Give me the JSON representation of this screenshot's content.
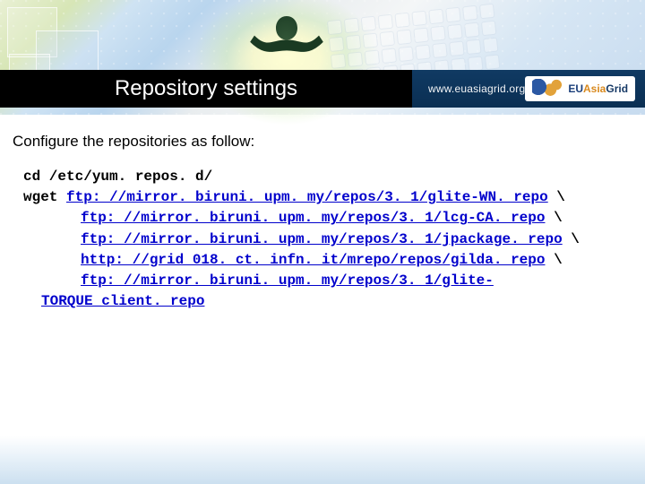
{
  "header": {
    "title": "Repository settings",
    "site_url": "www.euasiagrid.org",
    "brand": {
      "part1": "EU",
      "part2": "Asia",
      "part3": "Grid"
    }
  },
  "content": {
    "intro": "Configure the repositories as follow:",
    "cmd_cd": "cd /etc/yum. repos. d/",
    "cmd_wget": "wget",
    "links": {
      "l1": "ftp: //mirror. biruni. upm. my/repos/3. 1/glite-WN. repo",
      "l2": "ftp: //mirror. biruni. upm. my/repos/3. 1/lcg-CA. repo",
      "l3": "ftp: //mirror. biruni. upm. my/repos/3. 1/jpackage. repo",
      "l4": "http: //grid 018. ct. infn. it/mrepo/repos/gilda. repo",
      "l5a": "ftp: //mirror. biruni. upm. my/repos/3. 1/glite-",
      "l5b": "TORQUE_client. repo"
    },
    "backslash": " \\"
  }
}
